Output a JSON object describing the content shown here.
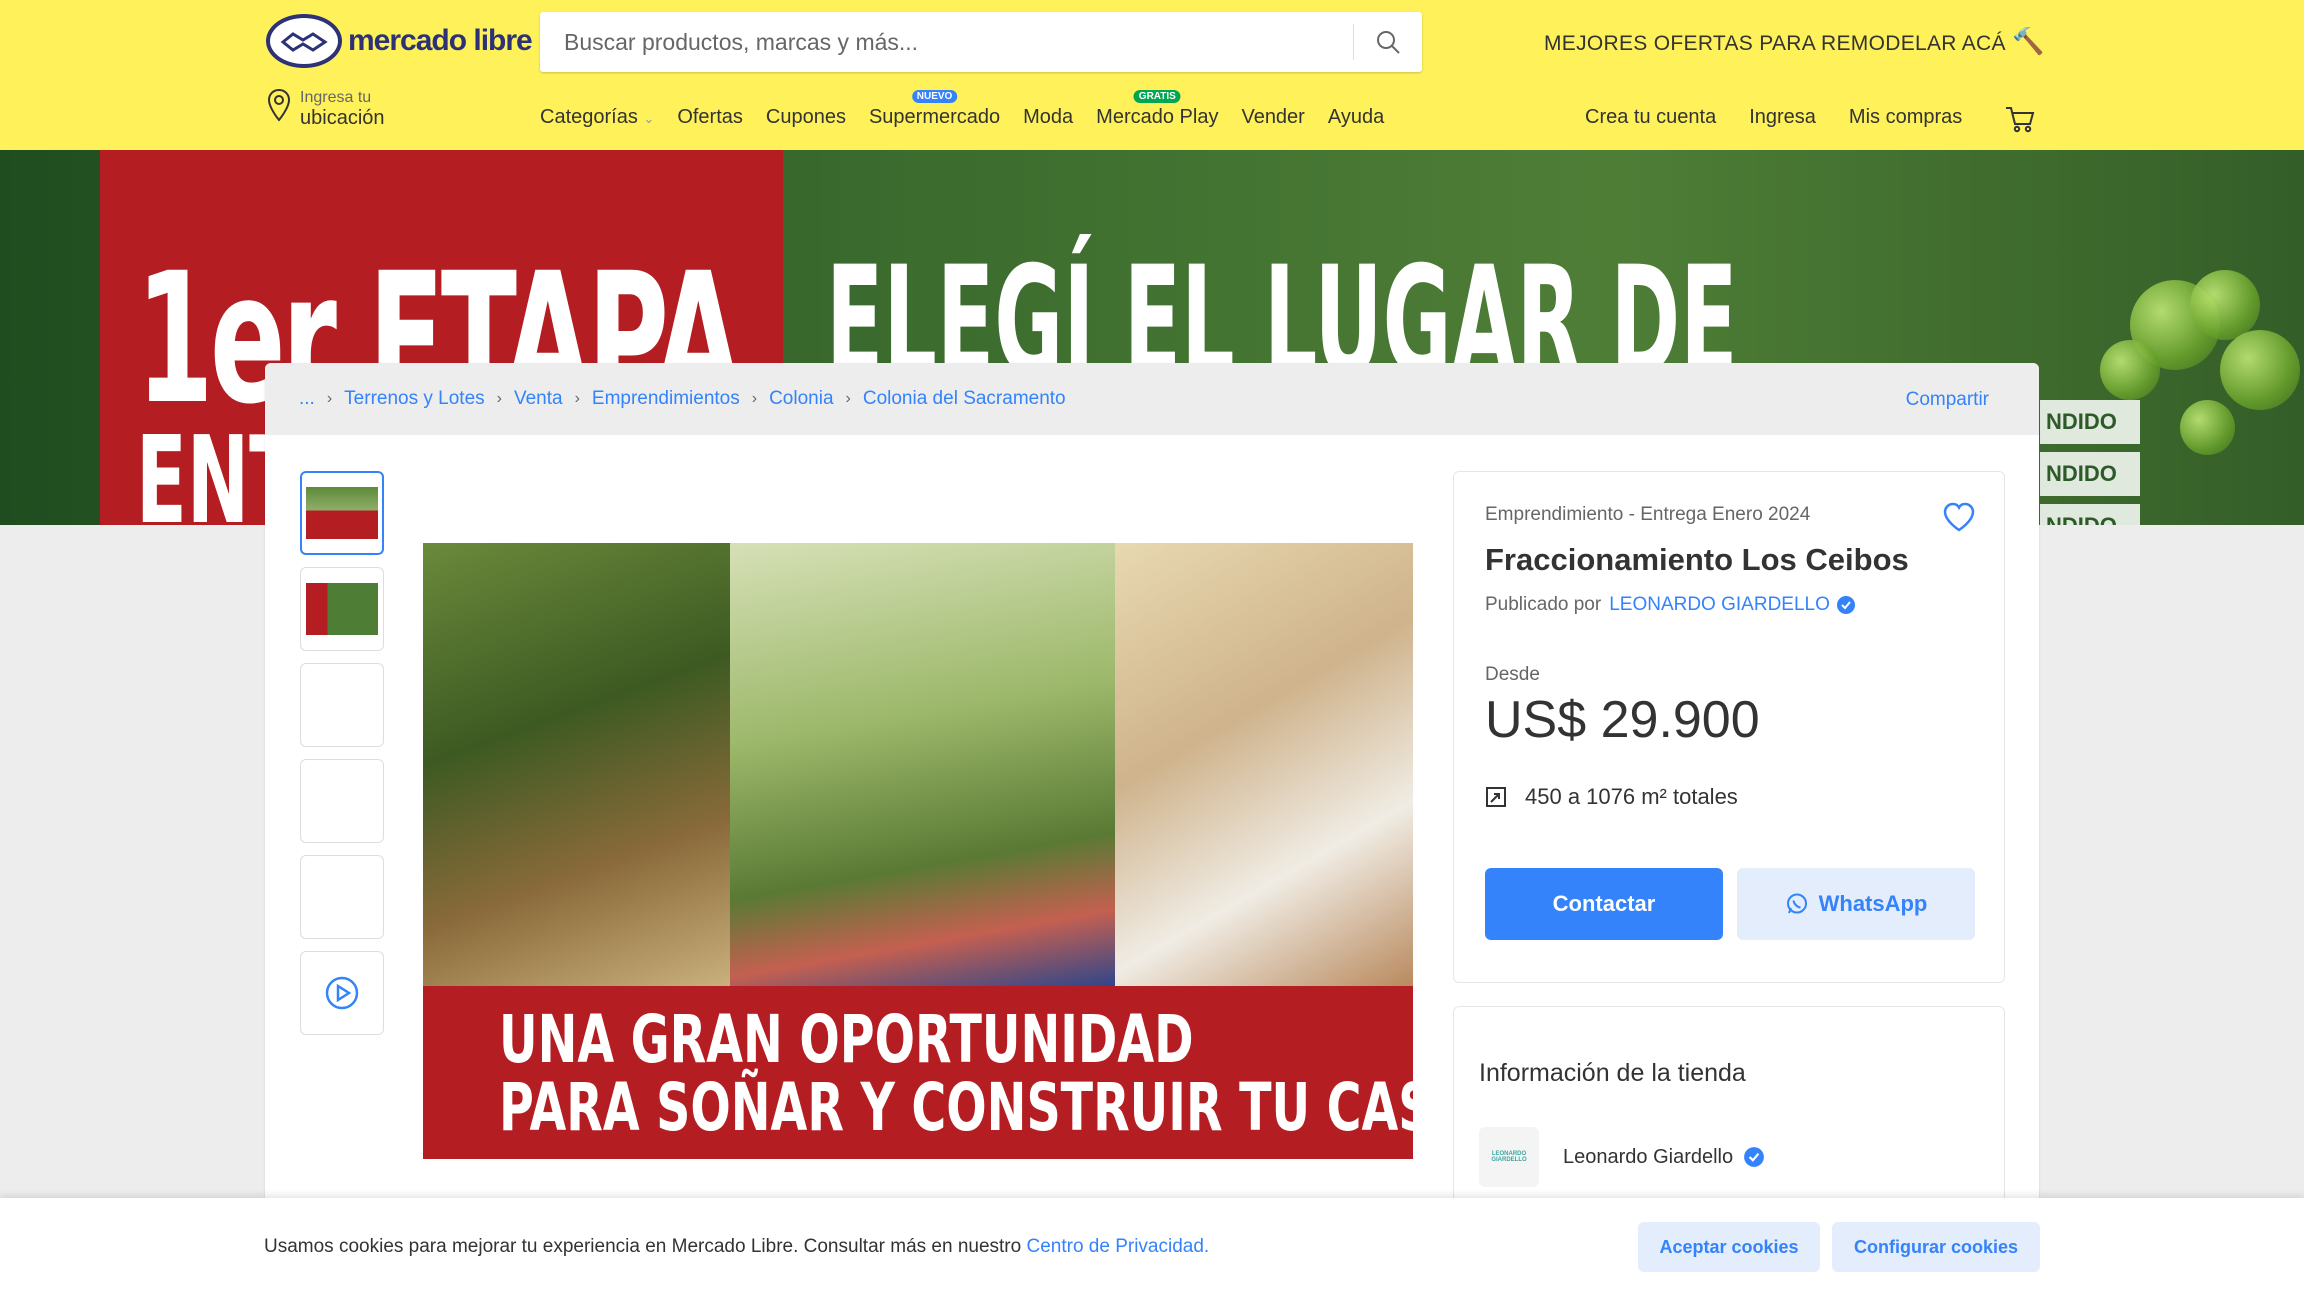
{
  "header": {
    "logo_text": "mercado libre",
    "search_placeholder": "Buscar productos, marcas y más...",
    "promo": "MEJORES OFERTAS PARA REMODELAR ACÁ",
    "location_line1": "Ingresa tu",
    "location_line2": "ubicación",
    "nav": [
      {
        "label": "Categorías",
        "badge": ""
      },
      {
        "label": "Ofertas",
        "badge": ""
      },
      {
        "label": "Cupones",
        "badge": ""
      },
      {
        "label": "Supermercado",
        "badge": "NUEVO"
      },
      {
        "label": "Moda",
        "badge": ""
      },
      {
        "label": "Mercado Play",
        "badge": "GRATIS"
      },
      {
        "label": "Vender",
        "badge": ""
      },
      {
        "label": "Ayuda",
        "badge": ""
      }
    ],
    "user_nav": [
      "Crea tu cuenta",
      "Ingresa",
      "Mis compras"
    ]
  },
  "banner": {
    "line1": "1er ETAPA",
    "line2": "ENTR",
    "line3": "ELEGÍ EL LUGAR DE",
    "sold_label": "NDIDO"
  },
  "breadcrumb": [
    "...",
    "Terrenos y Lotes",
    "Venta",
    "Emprendimientos",
    "Colonia",
    "Colonia del Sacramento"
  ],
  "share_label": "Compartir",
  "main_image_text": [
    "UNA GRAN OPORTUNIDAD",
    "PARA SOÑAR Y CONSTRUIR TU CASA"
  ],
  "listing": {
    "subtitle": "Emprendimiento - Entrega Enero 2024",
    "title": "Fraccionamiento Los Ceibos",
    "published_by": "Publicado por",
    "publisher": "LEONARDO GIARDELLO",
    "price_prefix": "Desde",
    "price": "US$ 29.900",
    "area": "450 a 1076 m² totales",
    "contact_label": "Contactar",
    "whatsapp_label": "WhatsApp"
  },
  "store": {
    "title": "Información de la tienda",
    "name": "Leonardo Giardello",
    "logo_text": "LEONARDO GIARDELLO"
  },
  "cookie": {
    "text": "Usamos cookies para mejorar tu experiencia en Mercado Libre. Consultar más en nuestro",
    "link": "Centro de Privacidad.",
    "accept": "Aceptar cookies",
    "configure": "Configurar cookies"
  },
  "colors": {
    "header_bg": "#fff159",
    "accent": "#3483fa",
    "banner_red": "#b41e22"
  }
}
